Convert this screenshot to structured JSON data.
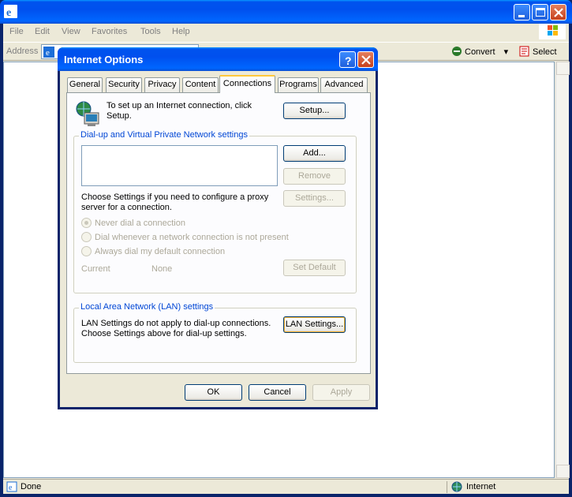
{
  "browser": {
    "menu": [
      "File",
      "Edit",
      "View",
      "Favorites",
      "Tools",
      "Help"
    ],
    "address_label": "Address",
    "toolbar_chevron": "»",
    "convert_label": "Convert",
    "select_label": "Select",
    "status_text": "Done",
    "zone_text": "Internet"
  },
  "dialog": {
    "title": "Internet Options",
    "tabs": [
      "General",
      "Security",
      "Privacy",
      "Content",
      "Connections",
      "Programs",
      "Advanced"
    ],
    "active_tab": "Connections",
    "setup_text": "To set up an Internet connection, click Setup.",
    "setup_button": "Setup...",
    "dialup_group": "Dial-up and Virtual Private Network settings",
    "add_button": "Add...",
    "remove_button": "Remove",
    "settings_text": "Choose Settings if you need to configure a proxy server for a connection.",
    "settings_button": "Settings...",
    "radios": [
      {
        "label": "Never dial a connection",
        "checked": true
      },
      {
        "label": "Dial whenever a network connection is not present",
        "checked": false
      },
      {
        "label": "Always dial my default connection",
        "checked": false
      }
    ],
    "current_label": "Current",
    "current_value": "None",
    "set_default_button": "Set Default",
    "lan_group": "Local Area Network (LAN) settings",
    "lan_text_1": "LAN Settings do not apply to dial-up connections.",
    "lan_text_2": "Choose Settings above for dial-up settings.",
    "lan_button": "LAN Settings...",
    "ok_button": "OK",
    "cancel_button": "Cancel",
    "apply_button": "Apply"
  }
}
